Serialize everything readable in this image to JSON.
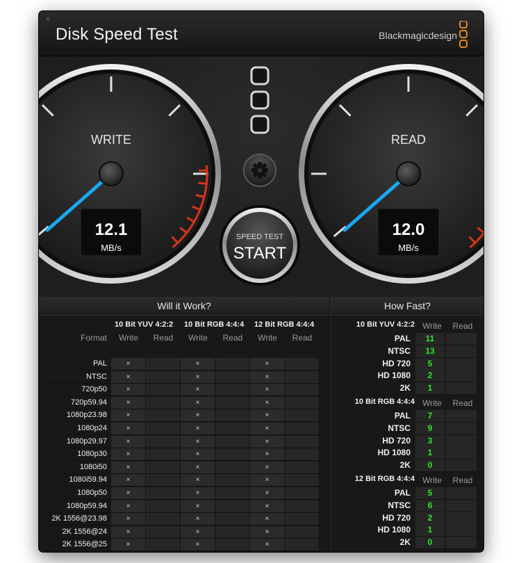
{
  "window": {
    "title": "Disk Speed Test",
    "brand": "Blackmagicdesign",
    "close_glyph": "×"
  },
  "gauges": {
    "write": {
      "label": "WRITE",
      "value": "12.1",
      "unit": "MB/s"
    },
    "read": {
      "label": "READ",
      "value": "12.0",
      "unit": "MB/s"
    }
  },
  "start_button": {
    "top_label": "SPEED TEST",
    "main_label": "START"
  },
  "colors": {
    "needle": "#19a8f0",
    "redline": "#d9331a",
    "ok_green": "#2fe62a",
    "background": "#111111"
  },
  "will_it_work": {
    "title": "Will it Work?",
    "format_header": "Format",
    "groups": [
      {
        "name": "10 Bit YUV 4:2:2",
        "write": "Write",
        "read": "Read"
      },
      {
        "name": "10 Bit RGB 4:4:4",
        "write": "Write",
        "read": "Read"
      },
      {
        "name": "12 Bit RGB 4:4:4",
        "write": "Write",
        "read": "Read"
      }
    ],
    "fail_mark": "×",
    "rows": [
      {
        "format": "PAL",
        "marks": [
          "×",
          "",
          "×",
          "",
          "×",
          ""
        ]
      },
      {
        "format": "NTSC",
        "marks": [
          "×",
          "",
          "×",
          "",
          "×",
          ""
        ]
      },
      {
        "format": "720p50",
        "marks": [
          "×",
          "",
          "×",
          "",
          "×",
          ""
        ]
      },
      {
        "format": "720p59.94",
        "marks": [
          "×",
          "",
          "×",
          "",
          "×",
          ""
        ]
      },
      {
        "format": "1080p23.98",
        "marks": [
          "×",
          "",
          "×",
          "",
          "×",
          ""
        ]
      },
      {
        "format": "1080p24",
        "marks": [
          "×",
          "",
          "×",
          "",
          "×",
          ""
        ]
      },
      {
        "format": "1080p29.97",
        "marks": [
          "×",
          "",
          "×",
          "",
          "×",
          ""
        ]
      },
      {
        "format": "1080p30",
        "marks": [
          "×",
          "",
          "×",
          "",
          "×",
          ""
        ]
      },
      {
        "format": "1080i50",
        "marks": [
          "×",
          "",
          "×",
          "",
          "×",
          ""
        ]
      },
      {
        "format": "1080i59.94",
        "marks": [
          "×",
          "",
          "×",
          "",
          "×",
          ""
        ]
      },
      {
        "format": "1080p50",
        "marks": [
          "×",
          "",
          "×",
          "",
          "×",
          ""
        ]
      },
      {
        "format": "1080p59.94",
        "marks": [
          "×",
          "",
          "×",
          "",
          "×",
          ""
        ]
      },
      {
        "format": "2K 1556@23.98",
        "marks": [
          "×",
          "",
          "×",
          "",
          "×",
          ""
        ]
      },
      {
        "format": "2K 1556@24",
        "marks": [
          "×",
          "",
          "×",
          "",
          "×",
          ""
        ]
      },
      {
        "format": "2K 1556@25",
        "marks": [
          "×",
          "",
          "×",
          "",
          "×",
          ""
        ]
      }
    ]
  },
  "how_fast": {
    "title": "How Fast?",
    "groups": [
      {
        "name": "10 Bit YUV 4:2:2",
        "write": "Write",
        "read": "Read",
        "rows": [
          {
            "format": "PAL",
            "write": "11",
            "read": ""
          },
          {
            "format": "NTSC",
            "write": "13",
            "read": ""
          },
          {
            "format": "HD 720",
            "write": "5",
            "read": ""
          },
          {
            "format": "HD 1080",
            "write": "2",
            "read": ""
          },
          {
            "format": "2K",
            "write": "1",
            "read": ""
          }
        ]
      },
      {
        "name": "10 Bit RGB 4:4:4",
        "write": "Write",
        "read": "Read",
        "rows": [
          {
            "format": "PAL",
            "write": "7",
            "read": ""
          },
          {
            "format": "NTSC",
            "write": "9",
            "read": ""
          },
          {
            "format": "HD 720",
            "write": "3",
            "read": ""
          },
          {
            "format": "HD 1080",
            "write": "1",
            "read": ""
          },
          {
            "format": "2K",
            "write": "0",
            "read": ""
          }
        ]
      },
      {
        "name": "12 Bit RGB 4:4:4",
        "write": "Write",
        "read": "Read",
        "rows": [
          {
            "format": "PAL",
            "write": "5",
            "read": ""
          },
          {
            "format": "NTSC",
            "write": "6",
            "read": ""
          },
          {
            "format": "HD 720",
            "write": "2",
            "read": ""
          },
          {
            "format": "HD 1080",
            "write": "1",
            "read": ""
          },
          {
            "format": "2K",
            "write": "0",
            "read": ""
          }
        ]
      }
    ]
  }
}
